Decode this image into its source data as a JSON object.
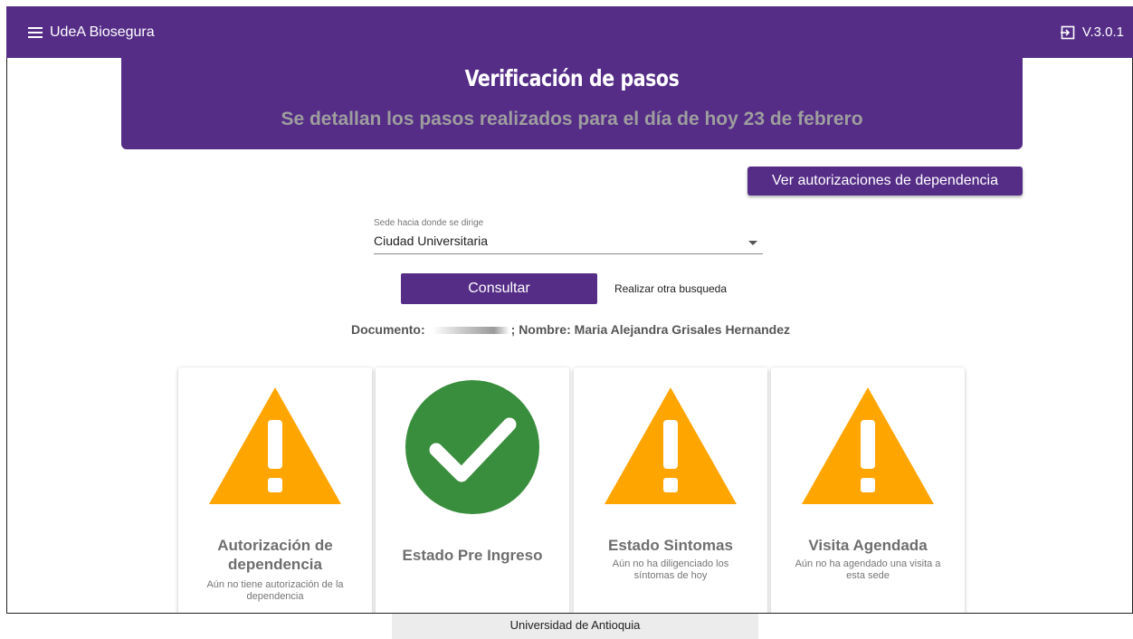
{
  "app": {
    "title": "UdeA Biosegura",
    "version": "V.3.0.1"
  },
  "banner": {
    "title": "Verificación de pasos",
    "subtitle": "Se detallan los pasos realizados para el día de hoy 23 de febrero"
  },
  "actions": {
    "authorizations_label": "Ver autorizaciones de dependencia",
    "consult_label": "Consultar",
    "other_search_label": "Realizar otra busqueda"
  },
  "sede": {
    "label": "Sede hacia donde se dirige",
    "value": "Ciudad Universitaria"
  },
  "person": {
    "document_label": "Documento:",
    "name_label": "; Nombre:",
    "name": "Maria Alejandra Grisales Hernandez"
  },
  "cards": [
    {
      "title": "Autorización de dependencia",
      "description": "Aún no tiene autorización de la dependencia",
      "icon": "warning-icon",
      "color": "#ffa500"
    },
    {
      "title": "Estado Pre Ingreso",
      "description": "",
      "icon": "check-circle-icon",
      "color": "#388e3c"
    },
    {
      "title": "Estado Sintomas",
      "description": "Aún no ha diligenciado los síntomas de hoy",
      "icon": "warning-icon",
      "color": "#ffa500"
    },
    {
      "title": "Visita Agendada",
      "description": "Aún no ha agendado una visita a esta sede",
      "icon": "warning-icon",
      "color": "#ffa500"
    }
  ],
  "footer": {
    "text": "Universidad de Antioquia"
  },
  "colors": {
    "primary": "#552d87",
    "warning": "#ffa500",
    "success": "#388e3c"
  }
}
